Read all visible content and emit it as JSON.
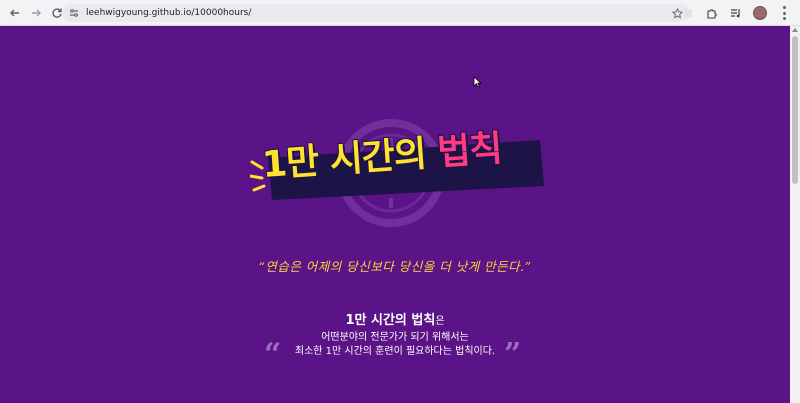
{
  "browser": {
    "url": "leehwigyoung.github.io/10000hours/",
    "back_icon": "back-arrow-icon",
    "forward_icon": "forward-arrow-icon",
    "reload_icon": "reload-icon",
    "site_info_icon": "site-info-icon",
    "bookmark_icon": "star-icon",
    "extensions_icon": "puzzle-icon",
    "media_icon": "media-controls-icon",
    "profile_icon": "avatar",
    "menu_icon": "menu-dots-icon"
  },
  "hero": {
    "title_main": "1만 시간의 ",
    "title_highlight": "법칙",
    "clock_icon": "clock-icon"
  },
  "quote": "“연습은 어제의 당신보다 당신을 더 낫게 만든다.”",
  "description": {
    "title": "1만 시간의 법칙",
    "title_suffix": "은",
    "line1": "어떤분야의 전문가가 되기 위해서는",
    "line2": "최소한 1만 시간의 훈련이 필요하다는 법칙이다.",
    "open_quote": "“",
    "close_quote": "”"
  },
  "colors": {
    "background": "#5b1388",
    "title_yellow": "#ffe22f",
    "title_pink": "#ff3b83",
    "quote_gold": "#ffd23d",
    "quote_mark": "#9b6fbf"
  }
}
